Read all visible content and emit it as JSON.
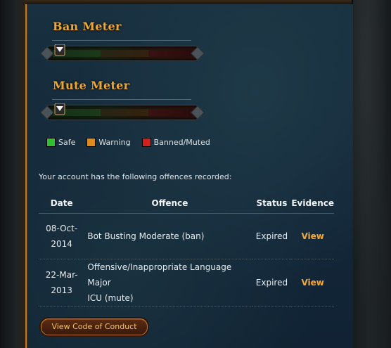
{
  "ban_meter": {
    "title": "Ban Meter",
    "level": 0.0
  },
  "mute_meter": {
    "title": "Mute Meter",
    "level": 0.0
  },
  "legend": {
    "items": [
      {
        "label": "Safe",
        "color": "#2fbf2f"
      },
      {
        "label": "Warning",
        "color": "#e08a1a"
      },
      {
        "label": "Banned/Muted",
        "color": "#d41f1f"
      }
    ]
  },
  "offences": {
    "intro": "Your account has the following offences recorded:",
    "columns": {
      "date": "Date",
      "offence": "Offence",
      "status": "Status",
      "evidence": "Evidence"
    },
    "rows": [
      {
        "date_line1": "08-Oct-",
        "date_line2": "2014",
        "offence_line1": "Bot Busting Moderate (ban)",
        "offence_line2": "",
        "status": "Expired",
        "evidence": "View"
      },
      {
        "date_line1": "22-Mar-",
        "date_line2": "2013",
        "offence_line1": "Offensive/Inappropriate Language Major",
        "offence_line2": "ICU (mute)",
        "status": "Expired",
        "evidence": "View"
      }
    ]
  },
  "footer": {
    "coc_button": "View Code of Conduct"
  },
  "colors": {
    "accent": "#e8a83a",
    "link": "#f0a93a",
    "panel": "#14283a"
  }
}
